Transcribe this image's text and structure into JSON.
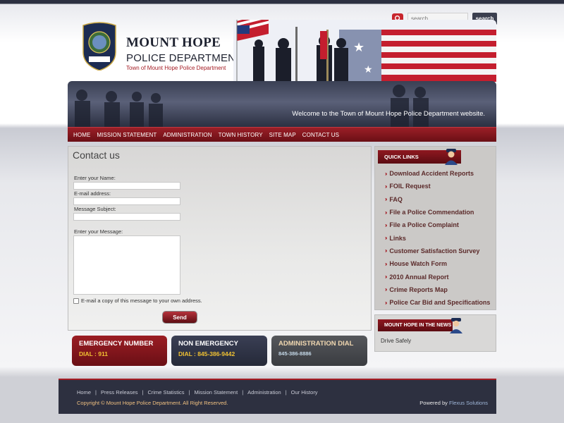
{
  "search": {
    "placeholder": "search...",
    "button": "search"
  },
  "brand": {
    "title": "MOUNT HOPE",
    "subtitle": "POLICE DEPARTMENT",
    "town": "Town of Mount Hope Police Department",
    "badge_top": "MOUNT HOPE",
    "badge_bottom": "POLICE"
  },
  "banner": {
    "welcome": "Welcome to the Town of Mount Hope Police Department website."
  },
  "nav": [
    "HOME",
    "MISSION STATEMENT",
    "ADMINISTRATION",
    "TOWN HISTORY",
    "SITE MAP",
    "CONTACT US"
  ],
  "contact": {
    "title": "Contact us",
    "name_label": "Enter your Name:",
    "email_label": "E-mail address:",
    "subject_label": "Message Subject:",
    "message_label": "Enter your Message:",
    "copy_label": "E-mail a copy of this message to your own address.",
    "send": "Send"
  },
  "quick_links": {
    "heading": "QUICK LINKS",
    "items": [
      "Download Accident Reports",
      "FOIL Request",
      "FAQ",
      "File a Police Commendation",
      "File a Police Complaint",
      "Links",
      "Customer Satisfaction Survey",
      "House Watch Form",
      "2010 Annual Report",
      "Crime Reports Map",
      "Police Car Bid and Specifications"
    ]
  },
  "news": {
    "heading": "MOUNT HOPE IN THE NEWS",
    "item": "Drive Safely"
  },
  "info": {
    "emergency": {
      "title": "EMERGENCY NUMBER",
      "value": "DIAL : 911"
    },
    "non_emergency": {
      "title": "NON EMERGENCY",
      "value": "DIAL : 845-386-9442"
    },
    "admin": {
      "title": "ADMINISTRATION DIAL",
      "value": "845-386-8886"
    }
  },
  "footer": {
    "links": [
      "Home",
      "Press Releases",
      "Crime Statistics",
      "Mission Statement",
      "Administration",
      "Our History"
    ],
    "copyright": "Copyright © Mount Hope Police Department. All Right Reserved.",
    "powered_prefix": "Powered by",
    "powered_by": "Flexus Solutions"
  },
  "colors": {
    "brand_red": "#a41c24",
    "navy": "#2d3040",
    "gold": "#f1c232"
  }
}
